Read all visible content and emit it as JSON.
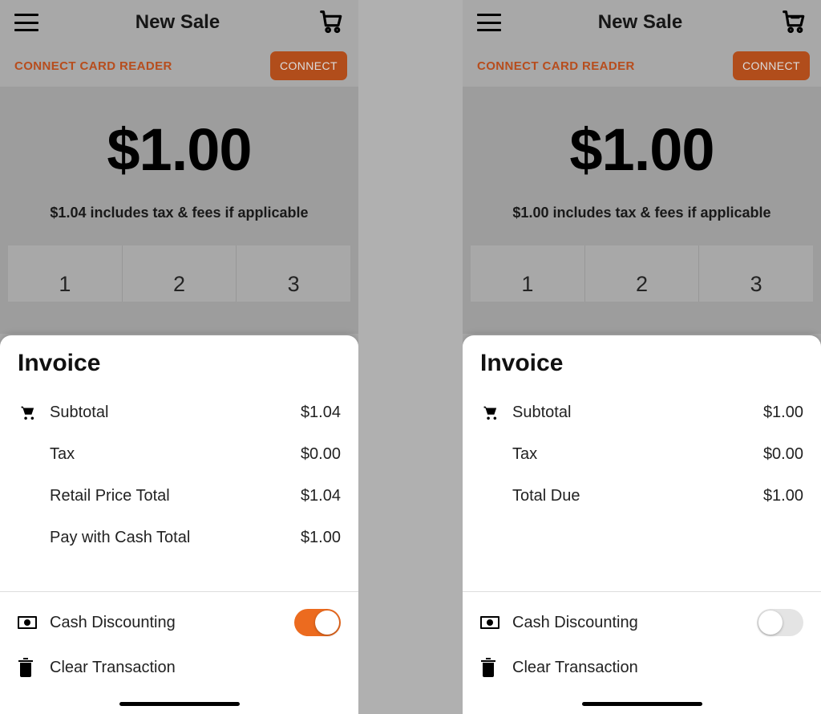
{
  "left": {
    "header": {
      "title": "New Sale"
    },
    "connect": {
      "label": "CONNECT CARD READER",
      "button": "CONNECT"
    },
    "amount": {
      "big": "$1.00",
      "sub": "$1.04 includes tax & fees if applicable"
    },
    "keys": [
      "1",
      "2",
      "3"
    ],
    "invoice": {
      "title": "Invoice",
      "rows": [
        {
          "label": "Subtotal",
          "value": "$1.04"
        },
        {
          "label": "Tax",
          "value": "$0.00"
        },
        {
          "label": "Retail Price Total",
          "value": "$1.04"
        },
        {
          "label": "Pay with Cash Total",
          "value": "$1.00"
        }
      ]
    },
    "actions": {
      "cash_discounting": "Cash Discounting",
      "clear_transaction": "Clear Transaction"
    }
  },
  "right": {
    "header": {
      "title": "New Sale"
    },
    "connect": {
      "label": "CONNECT CARD READER",
      "button": "CONNECT"
    },
    "amount": {
      "big": "$1.00",
      "sub": "$1.00 includes tax & fees if applicable"
    },
    "keys": [
      "1",
      "2",
      "3"
    ],
    "invoice": {
      "title": "Invoice",
      "rows": [
        {
          "label": "Subtotal",
          "value": "$1.00"
        },
        {
          "label": "Tax",
          "value": "$0.00"
        },
        {
          "label": "Total Due",
          "value": "$1.00"
        }
      ]
    },
    "actions": {
      "cash_discounting": "Cash Discounting",
      "clear_transaction": "Clear Transaction"
    }
  }
}
